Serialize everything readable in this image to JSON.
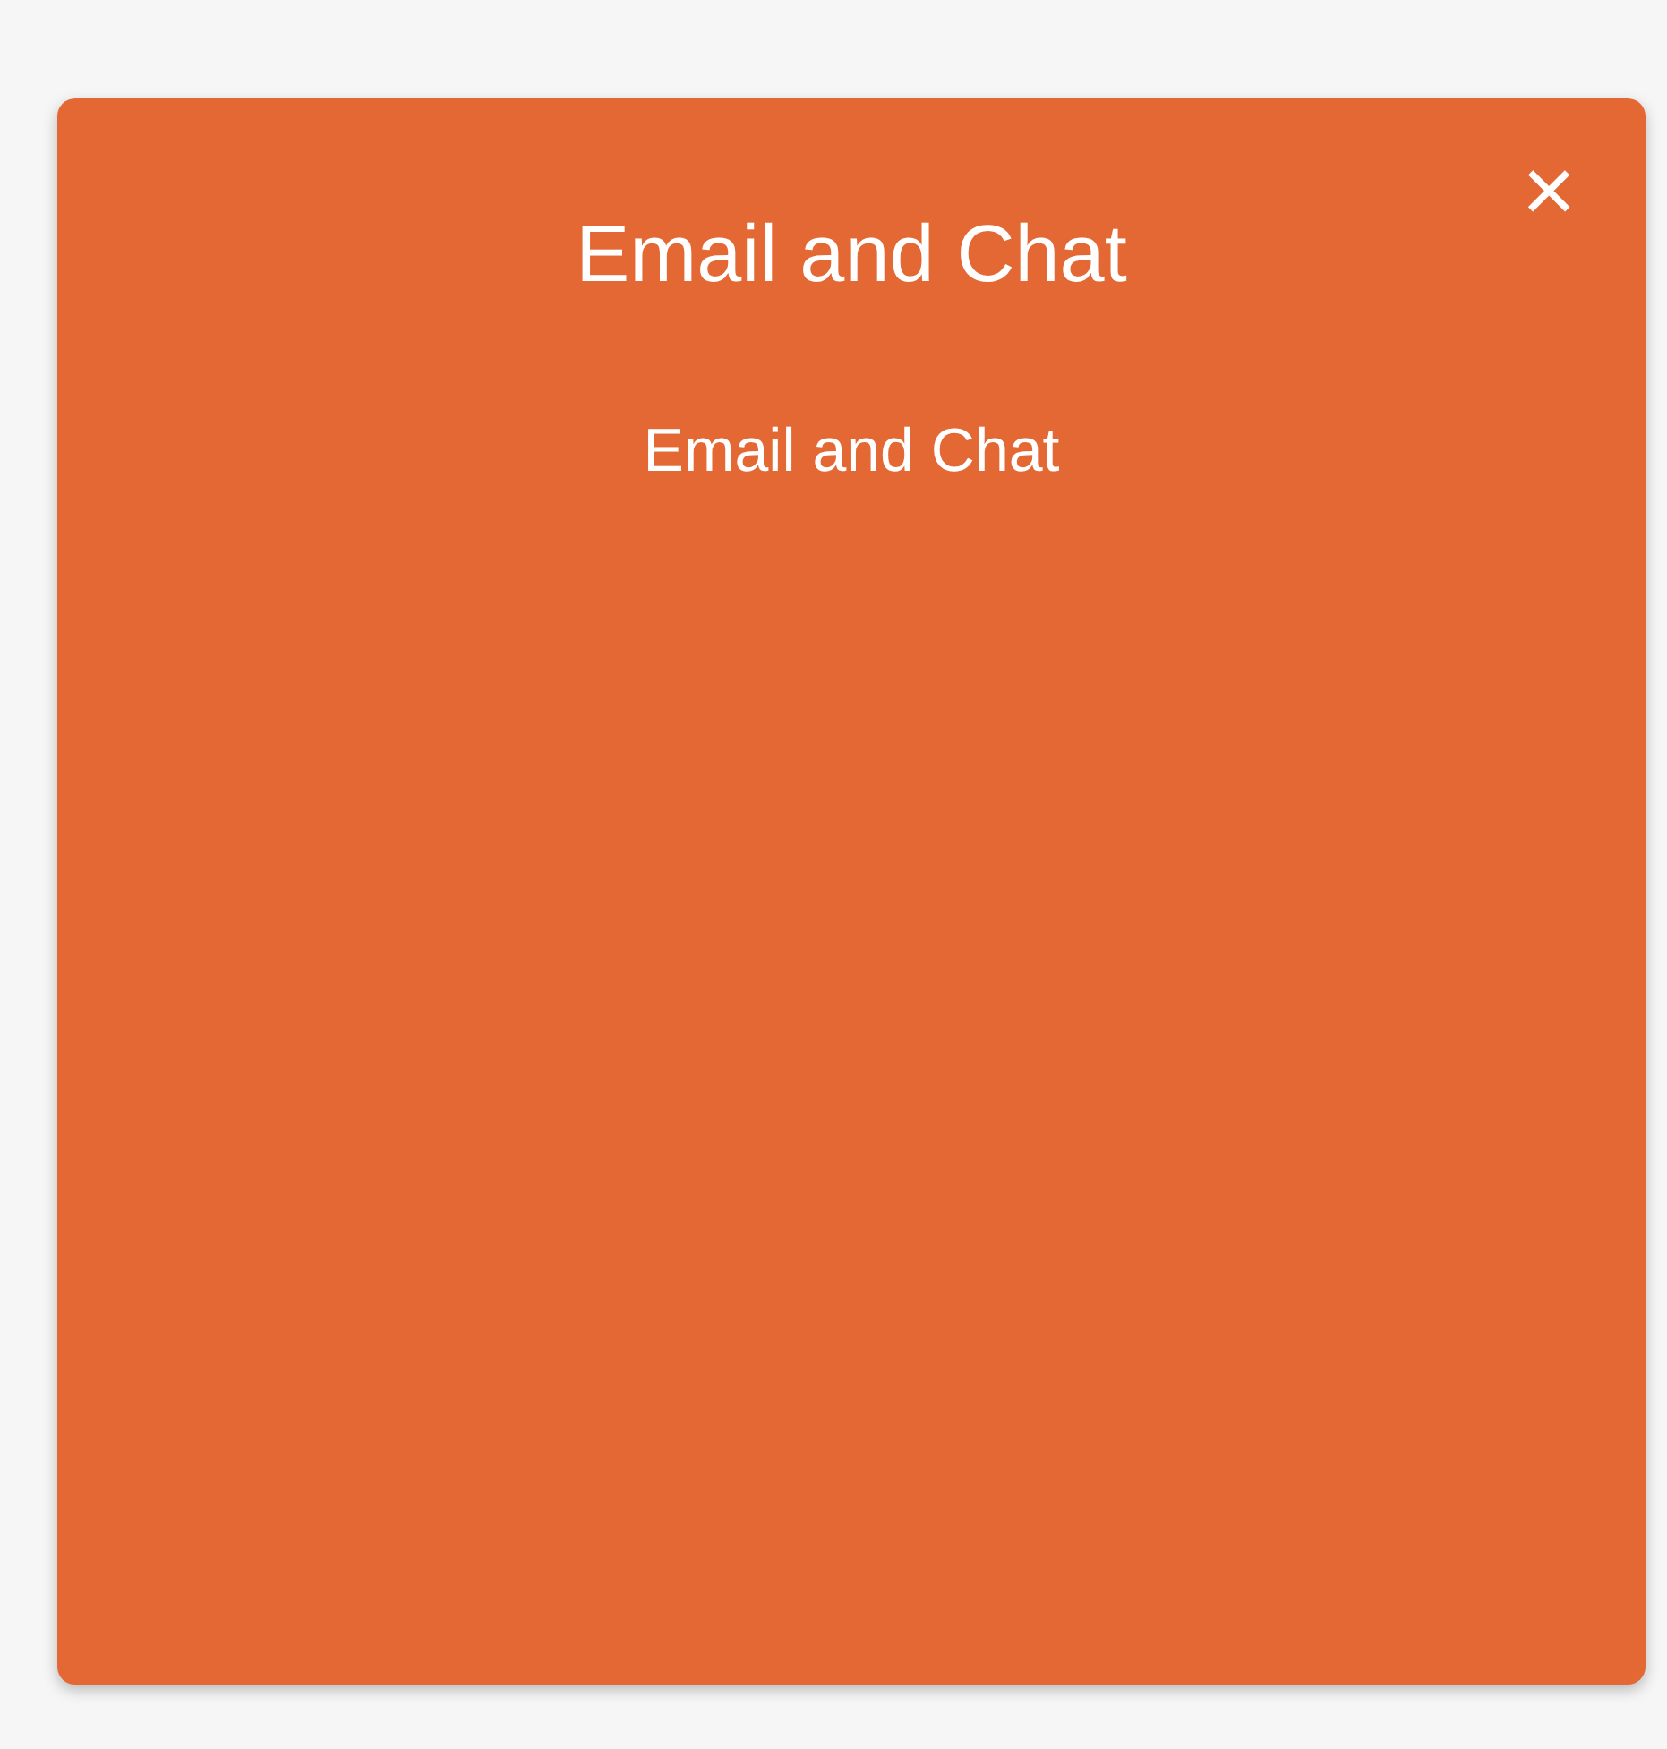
{
  "card": {
    "title": "Email and Chat",
    "subtitle": "Email and Chat",
    "close": {
      "label": "×"
    }
  }
}
